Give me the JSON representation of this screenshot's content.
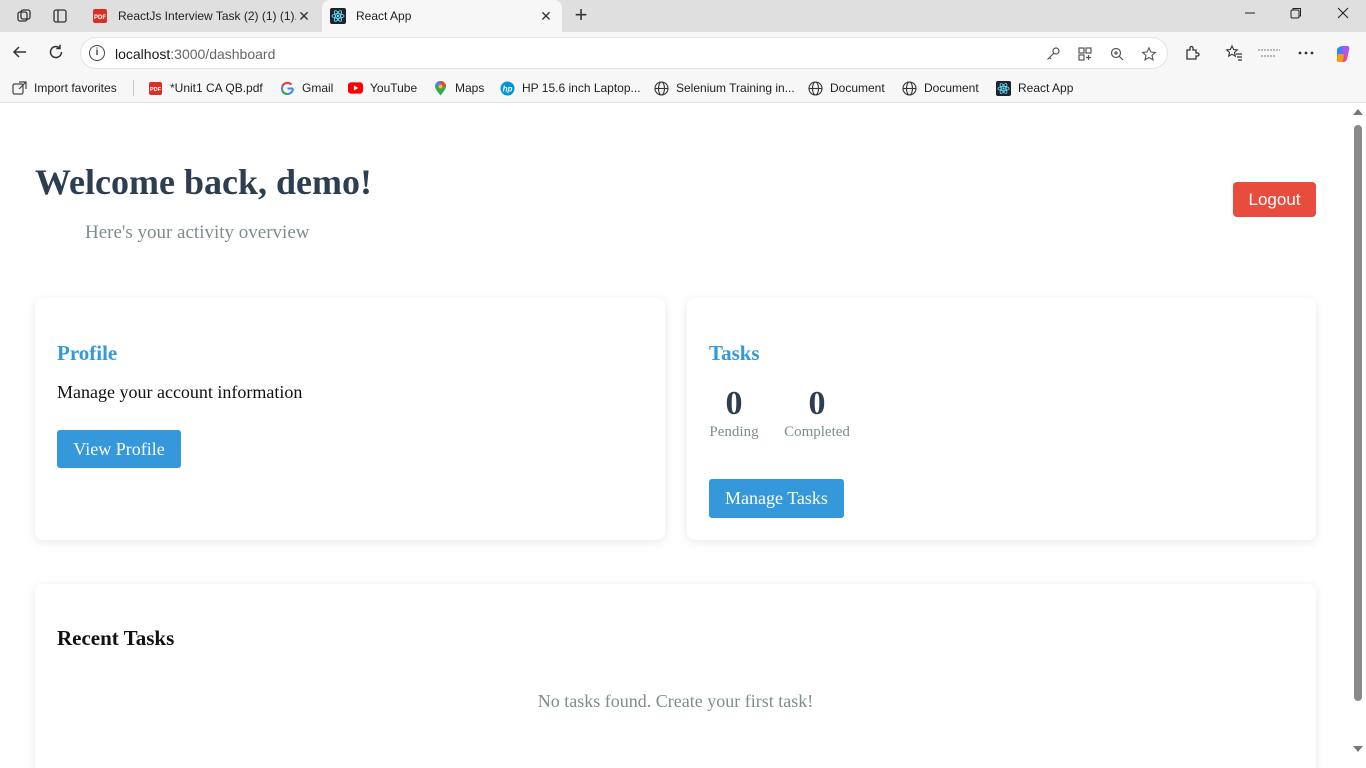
{
  "browser": {
    "tabs": [
      {
        "title": "ReactJs Interview Task (2) (1) (1).pdf",
        "icon": "pdf-icon",
        "active": false
      },
      {
        "title": "React App",
        "icon": "react-icon",
        "active": true
      }
    ],
    "close_glyph": "✕",
    "new_tab_glyph": "+",
    "address": {
      "host": "localhost",
      "path": ":3000/dashboard"
    },
    "favorites": [
      {
        "label": "Import favorites",
        "icon": "import-icon"
      },
      {
        "label": "*Unit1 CA QB.pdf",
        "icon": "pdf-icon"
      },
      {
        "label": "Gmail",
        "icon": "google-icon"
      },
      {
        "label": "YouTube",
        "icon": "youtube-icon"
      },
      {
        "label": "Maps",
        "icon": "maps-pin-icon"
      },
      {
        "label": "HP 15.6 inch Laptop...",
        "icon": "hp-icon"
      },
      {
        "label": "Selenium Training in...",
        "icon": "globe-icon"
      },
      {
        "label": "Document",
        "icon": "globe-icon"
      },
      {
        "label": "Document",
        "icon": "globe-icon"
      },
      {
        "label": "React App",
        "icon": "react-icon"
      }
    ]
  },
  "page": {
    "welcome": "Welcome back, demo!",
    "subtitle": "Here's your activity overview",
    "logout_label": "Logout",
    "profile": {
      "title": "Profile",
      "description": "Manage your account information",
      "button": "View Profile"
    },
    "tasks": {
      "title": "Tasks",
      "pending_count": "0",
      "pending_label": "Pending",
      "completed_count": "0",
      "completed_label": "Completed",
      "button": "Manage Tasks"
    },
    "recent": {
      "title": "Recent Tasks",
      "empty_message": "No tasks found. Create your first task!"
    }
  },
  "colors": {
    "heading": "#2c3e50",
    "accent_blue": "#3498db",
    "logout_red": "#e74c3c",
    "muted_gray": "#7f8c8d"
  }
}
